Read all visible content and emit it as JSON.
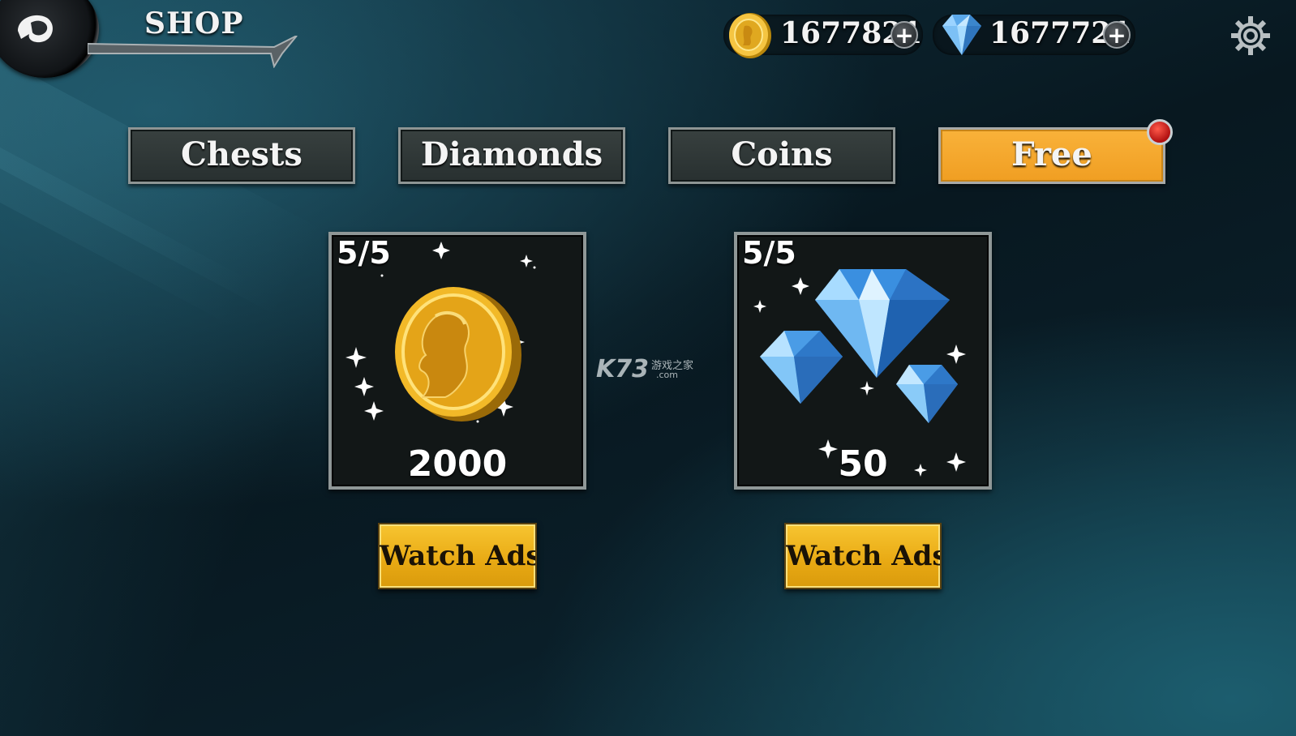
{
  "header": {
    "title": "SHOP",
    "coins": {
      "value": "1677821",
      "icon": "coin-icon",
      "plus": "+"
    },
    "gems": {
      "value": "1677721",
      "icon": "diamond-icon",
      "plus": "+"
    },
    "settings_icon": "gear-icon",
    "back_icon": "back-arrow-icon"
  },
  "tabs": [
    {
      "label": "Chests",
      "active": false
    },
    {
      "label": "Diamonds",
      "active": false
    },
    {
      "label": "Coins",
      "active": false
    },
    {
      "label": "Free",
      "active": true,
      "has_notification": true
    }
  ],
  "offers": [
    {
      "count": "5/5",
      "amount": "2000",
      "reward": "coin",
      "button": "Watch Ads"
    },
    {
      "count": "5/5",
      "amount": "50",
      "reward": "diamonds",
      "button": "Watch Ads"
    }
  ],
  "watermark": {
    "logo": "K73",
    "text": "游戏之家",
    "domain": ".com"
  },
  "colors": {
    "tab_active": "#f4a82c",
    "tab_inactive": "#303837",
    "button_gold": "#edb01c",
    "notification": "#d42a1a"
  }
}
